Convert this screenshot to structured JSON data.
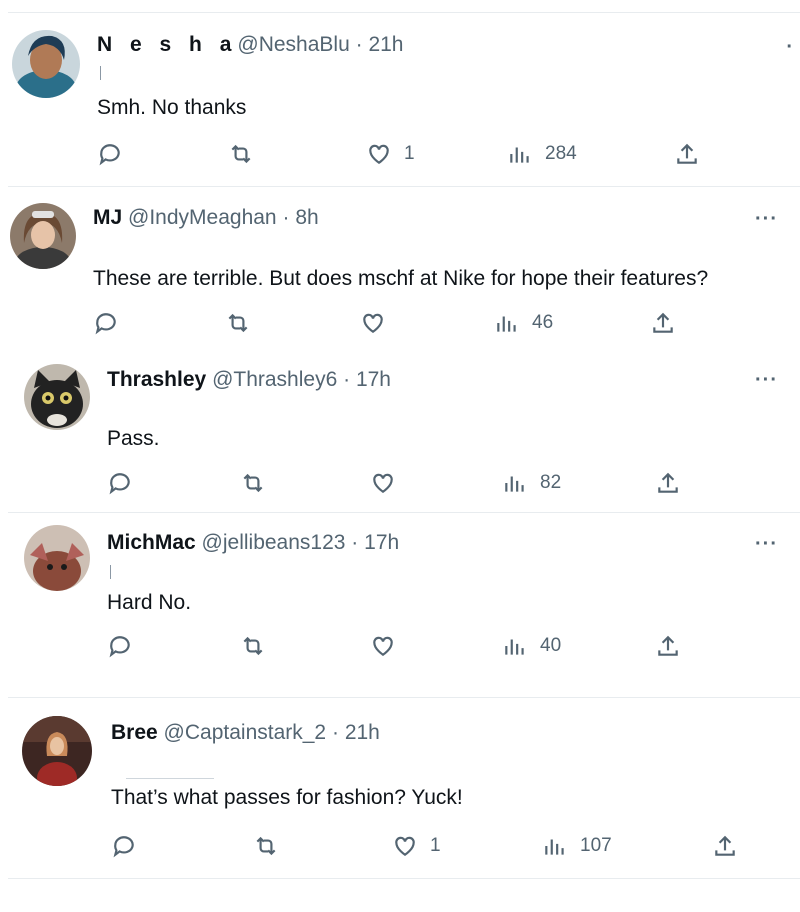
{
  "tweets": [
    {
      "name": "N e s h a",
      "handle": "@NeshaBlu",
      "time": "21h",
      "text": "Smh. No thanks",
      "likes": "1",
      "views": "284",
      "more": "·"
    },
    {
      "name": "MJ",
      "handle": "@IndyMeaghan",
      "time": "8h",
      "text": "These are terrible. But does mschf at Nike for hope their features?",
      "likes": "",
      "views": "46",
      "more": "···"
    },
    {
      "name": "Thrashley",
      "handle": "@Thrashley6",
      "time": "17h",
      "text": "Pass.",
      "likes": "",
      "views": "82",
      "more": "···"
    },
    {
      "name": "MichMac",
      "handle": "@jellibeans123",
      "time": "17h",
      "text": "Hard No.",
      "likes": "",
      "views": "40",
      "more": "···"
    },
    {
      "name": "Bree",
      "handle": "@Captainstark_2",
      "time": "21h",
      "text": "That’s what passes for fashion? Yuck!",
      "likes": "1",
      "views": "107",
      "more": ""
    }
  ],
  "separator": "·",
  "icons": [
    "reply-icon",
    "retweet-icon",
    "like-icon",
    "views-icon",
    "share-icon"
  ],
  "colors": {
    "text": "#0f1419",
    "secondary": "#536471",
    "divider": "#e8ecef"
  }
}
